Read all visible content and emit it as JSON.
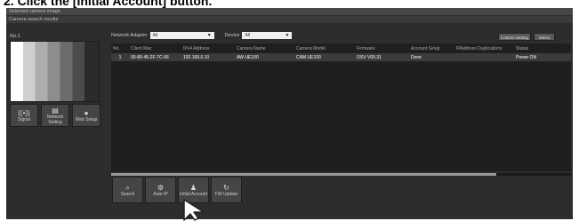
{
  "heading": "2. Click the [Initial Account] button.",
  "window": {
    "title_bar": "Selected camera image",
    "section_bar": "Camera search results"
  },
  "preview": {
    "camera_label": "No.1"
  },
  "tools": [
    {
      "icon": "((•))",
      "label": "Signal"
    },
    {
      "icon": "▤",
      "label": "Network Setting"
    },
    {
      "icon": "●",
      "label": "Web Setup"
    }
  ],
  "filters": {
    "network_adapter_label": "Network Adapter",
    "network_adapter_value": "All",
    "device_label": "Device",
    "device_value": "All"
  },
  "header_buttons": {
    "column_setting": "Column Setting",
    "select": "Select"
  },
  "table": {
    "columns": [
      "No.",
      "Client Mac",
      "IPv4 Address",
      "Camera Name",
      "Camera Model",
      "Firmware",
      "Account Setup",
      "IPAddress Duplications",
      "Status"
    ],
    "rows": [
      [
        "1",
        "00-80-45-2F-7C-66",
        "192.168.0.10",
        "AW-UE100",
        "CAM UE100",
        "OSV V00.31",
        "Done",
        "",
        "Power ON"
      ]
    ]
  },
  "actions": [
    {
      "icon": "⌕",
      "label": "Search"
    },
    {
      "icon": "⚙",
      "label": "Auto IP"
    },
    {
      "icon": "♟",
      "label": "Initial Account"
    },
    {
      "icon": "↻",
      "label": "FW Update"
    }
  ]
}
